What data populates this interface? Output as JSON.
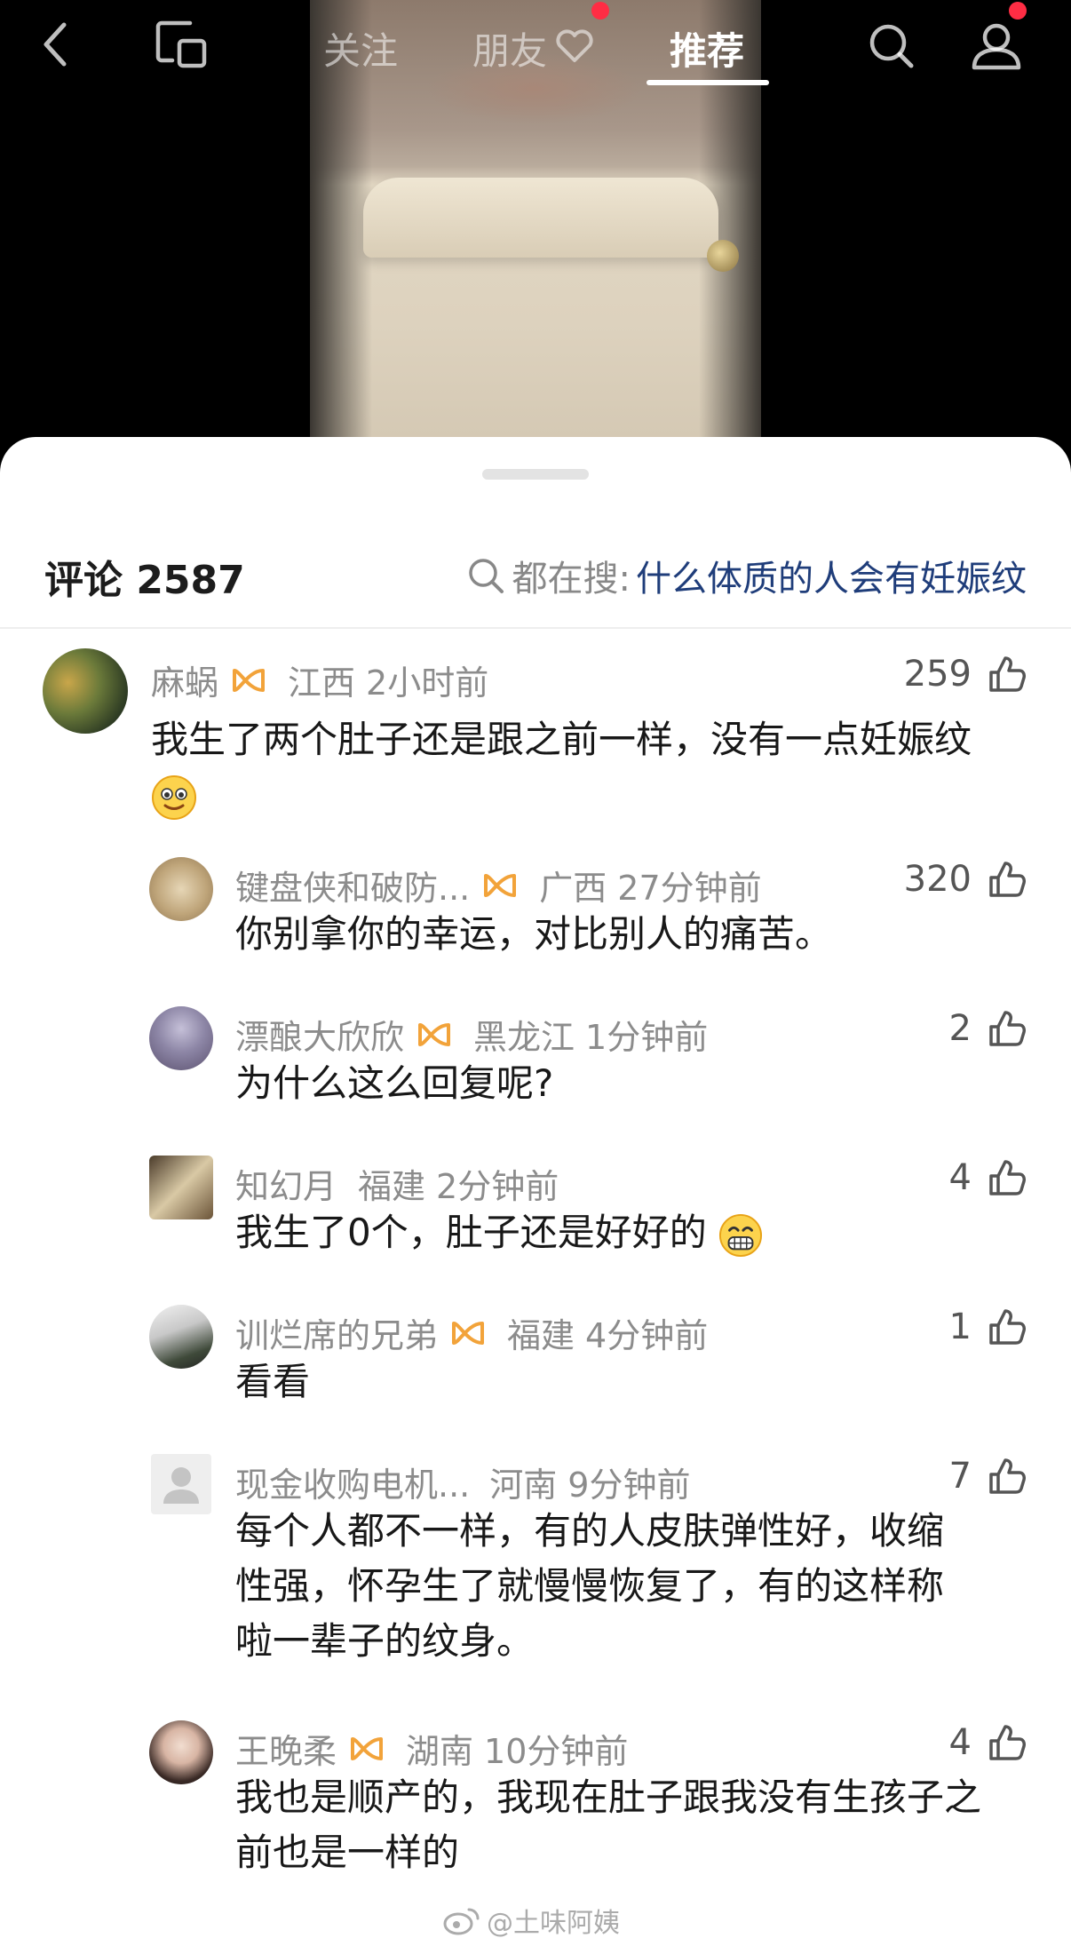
{
  "nav": {
    "tabs": [
      {
        "label": "关注"
      },
      {
        "label": "朋友"
      },
      {
        "label": "推荐"
      }
    ],
    "active_tab": "推荐",
    "back_icon": "chevron-left-icon",
    "screen_icon": "screen-cast-icon",
    "search_icon": "search-icon",
    "profile_icon": "user-icon",
    "notification_color": "#ff2d44"
  },
  "header": {
    "comment_label": "评论 2587",
    "search_prefix": "都在搜:",
    "search_term": "什么体质的人会有妊娠纹"
  },
  "comments": [
    {
      "name": "麻蜗",
      "badge": true,
      "place": "江西",
      "time": "2小时前",
      "likes": "259",
      "text": "我生了两个肚子还是跟之前一样，没有一点妊娠纹",
      "emoji": "smile-emoji"
    },
    {
      "name": "键盘侠和破防...",
      "badge": true,
      "place": "广西",
      "time": "27分钟前",
      "likes": "320",
      "text": "你别拿你的幸运，对比别人的痛苦。"
    },
    {
      "name": "漂酿大欣欣",
      "badge": true,
      "place": "黑龙江",
      "time": "1分钟前",
      "likes": "2",
      "text": "为什么这么回复呢?"
    },
    {
      "name": "知幻月",
      "badge": false,
      "place": "福建",
      "time": "2分钟前",
      "likes": "4",
      "text": "我生了0个，肚子还是好好的",
      "emoji": "grin-emoji"
    },
    {
      "name": "训烂席的兄弟",
      "badge": true,
      "place": "福建",
      "time": "4分钟前",
      "likes": "1",
      "text": "看看"
    },
    {
      "name": "现金收购电机...",
      "badge": false,
      "place": "河南",
      "time": "9分钟前",
      "likes": "7",
      "text_lines": [
        "每个人都不一样，有的人皮肤弹性好，收缩",
        "性强，怀孕生了就慢慢恢复了，有的这样称",
        "啦一辈子的纹身。"
      ]
    },
    {
      "name": "王晚柔",
      "badge": true,
      "place": "湖南",
      "time": "10分钟前",
      "likes": "4",
      "text_lines": [
        "我也是顺产的，我现在肚子跟我没有生孩子之",
        "前也是一样的"
      ]
    }
  ],
  "watermark": "@土味阿姨",
  "colors": {
    "badge": "#f2a33a",
    "search_term": "#1f3d7a",
    "meta": "#8c8c8c"
  }
}
